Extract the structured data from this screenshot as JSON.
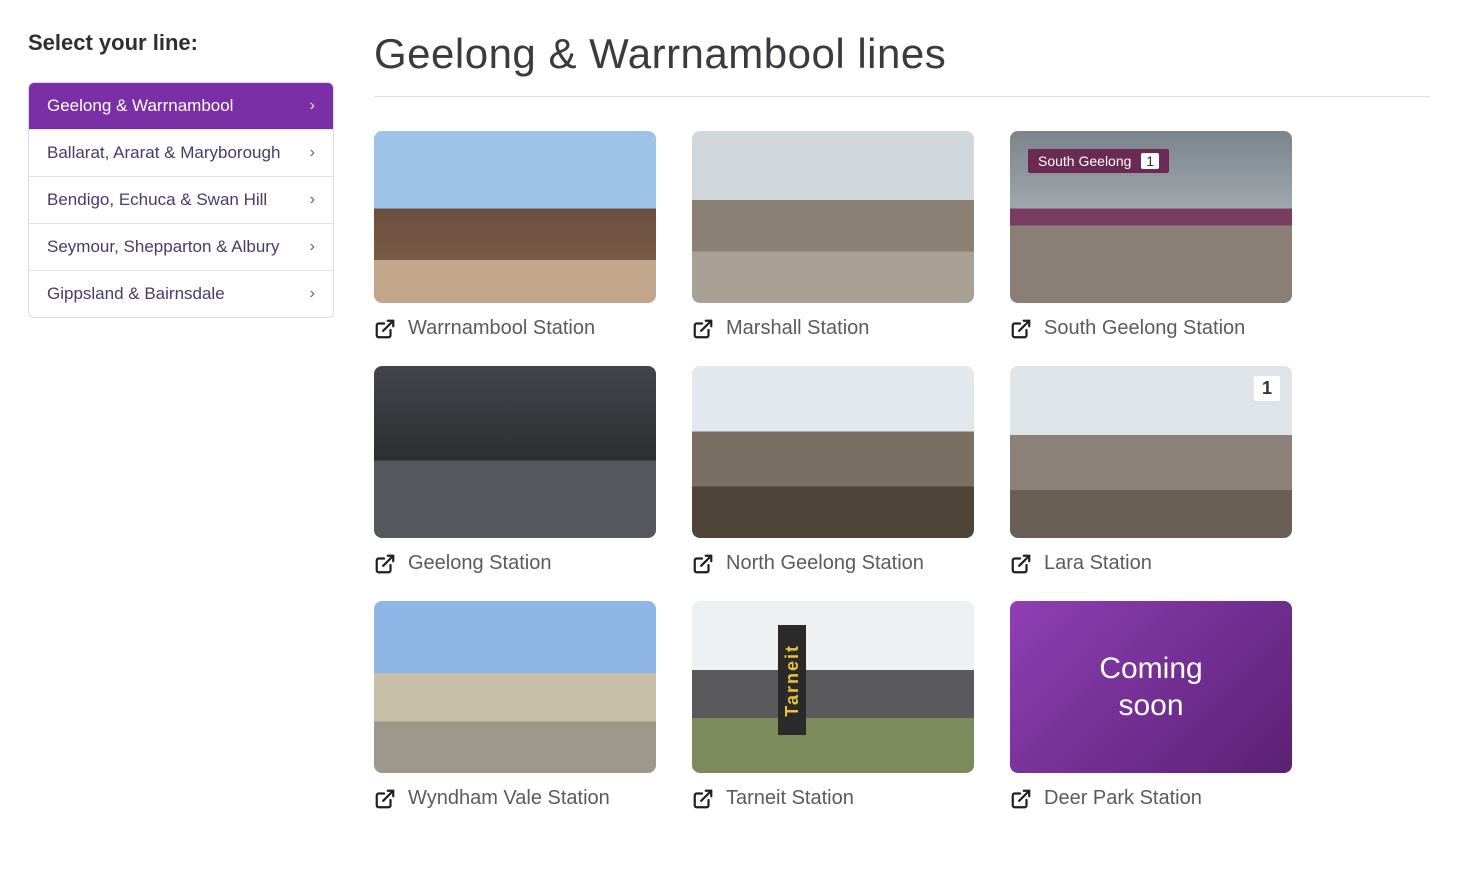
{
  "sidebar": {
    "title": "Select your line:",
    "items": [
      {
        "label": "Geelong & Warrnambool",
        "active": true
      },
      {
        "label": "Ballarat, Ararat & Maryborough",
        "active": false
      },
      {
        "label": "Bendigo, Echuca & Swan Hill",
        "active": false
      },
      {
        "label": "Seymour, Shepparton & Albury",
        "active": false
      },
      {
        "label": "Gippsland & Bairnsdale",
        "active": false
      }
    ]
  },
  "main": {
    "title": "Geelong & Warrnambool lines"
  },
  "stations": [
    {
      "name": "Warrnambool Station"
    },
    {
      "name": "Marshall Station"
    },
    {
      "name": "South Geelong Station",
      "sign_text": "South Geelong",
      "sign_platform": "1"
    },
    {
      "name": "Geelong Station"
    },
    {
      "name": "North Geelong Station"
    },
    {
      "name": "Lara Station",
      "platform_badge": "1"
    },
    {
      "name": "Wyndham Vale Station"
    },
    {
      "name": "Tarneit Station",
      "tarneit_sign": "Tarneit"
    },
    {
      "name": "Deer Park Station",
      "overlay_text": "Coming\nsoon"
    }
  ],
  "icons": {
    "chevron": "›",
    "external_link": "external-link-icon"
  }
}
